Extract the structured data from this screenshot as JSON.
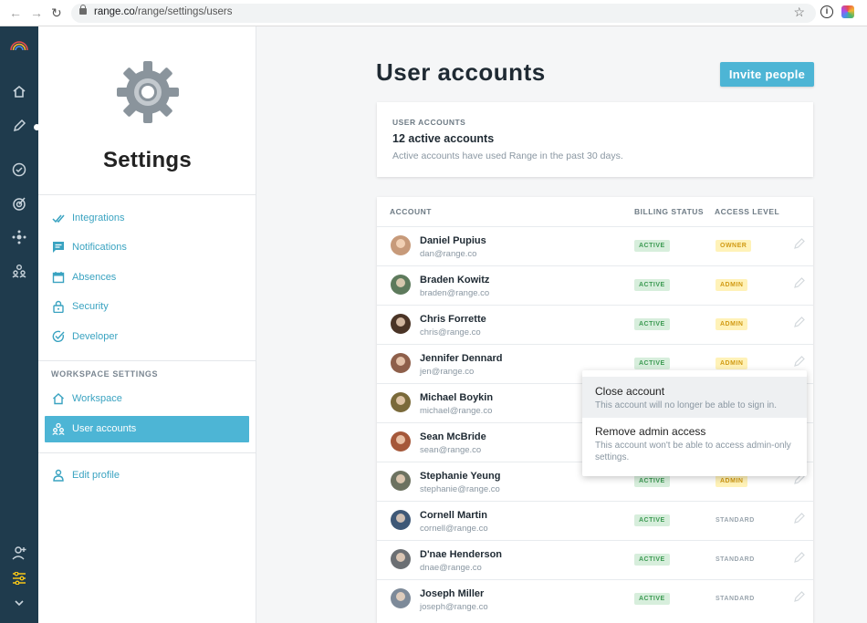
{
  "browser": {
    "url_host": "range.co",
    "url_path": "/range/settings/users",
    "back_icon": "arrow-left-icon",
    "forward_icon": "arrow-right-icon",
    "reload_icon": "reload-icon"
  },
  "rail": {
    "icons": [
      "rainbow-logo-icon",
      "home-icon",
      "pencil-icon",
      "check-circle-icon",
      "target-icon",
      "network-icon",
      "team-icon",
      "add-user-icon",
      "settings-sliders-icon",
      "chevron-down-icon"
    ],
    "active_icon_color": "#f5c518"
  },
  "sidebar": {
    "title": "Settings",
    "items": [
      {
        "label": "Integrations",
        "icon": "check-double-icon"
      },
      {
        "label": "Notifications",
        "icon": "chat-icon"
      },
      {
        "label": "Absences",
        "icon": "calendar-icon"
      },
      {
        "label": "Security",
        "icon": "lock-icon"
      },
      {
        "label": "Developer",
        "icon": "check-circle-icon"
      }
    ],
    "workspace_heading": "WORKSPACE SETTINGS",
    "workspace_items": [
      {
        "label": "Workspace",
        "icon": "home-icon"
      },
      {
        "label": "User accounts",
        "icon": "users-icon",
        "active": true
      }
    ],
    "profile_item": {
      "label": "Edit profile",
      "icon": "person-icon"
    },
    "accent": "#4db5d5"
  },
  "main": {
    "title": "User accounts",
    "invite_label": "Invite people",
    "summary": {
      "heading": "USER ACCOUNTS",
      "count": "12 active accounts",
      "description": "Active accounts have used Range in the past 30 days."
    },
    "table": {
      "columns": {
        "account": "ACCOUNT",
        "billing": "BILLING STATUS",
        "access": "ACCESS LEVEL"
      },
      "rows": [
        {
          "name": "Daniel Pupius",
          "email": "dan@range.co",
          "billing": "ACTIVE",
          "access": "OWNER"
        },
        {
          "name": "Braden Kowitz",
          "email": "braden@range.co",
          "billing": "ACTIVE",
          "access": "ADMIN"
        },
        {
          "name": "Chris Forrette",
          "email": "chris@range.co",
          "billing": "ACTIVE",
          "access": "ADMIN"
        },
        {
          "name": "Jennifer Dennard",
          "email": "jen@range.co",
          "billing": "ACTIVE",
          "access": "ADMIN"
        },
        {
          "name": "Michael Boykin",
          "email": "michael@range.co",
          "billing": "",
          "access": ""
        },
        {
          "name": "Sean McBride",
          "email": "sean@range.co",
          "billing": "",
          "access": ""
        },
        {
          "name": "Stephanie Yeung",
          "email": "stephanie@range.co",
          "billing": "ACTIVE",
          "access": "ADMIN"
        },
        {
          "name": "Cornell Martin",
          "email": "cornell@range.co",
          "billing": "ACTIVE",
          "access": "STANDARD"
        },
        {
          "name": "D'nae Henderson",
          "email": "dnae@range.co",
          "billing": "ACTIVE",
          "access": "STANDARD"
        },
        {
          "name": "Joseph Miller",
          "email": "joseph@range.co",
          "billing": "ACTIVE",
          "access": "STANDARD"
        }
      ]
    }
  },
  "menu": {
    "items": [
      {
        "title": "Close account",
        "description": "This account will no longer be able to sign in."
      },
      {
        "title": "Remove admin access",
        "description": "This account won't be able to access admin-only settings."
      }
    ]
  }
}
